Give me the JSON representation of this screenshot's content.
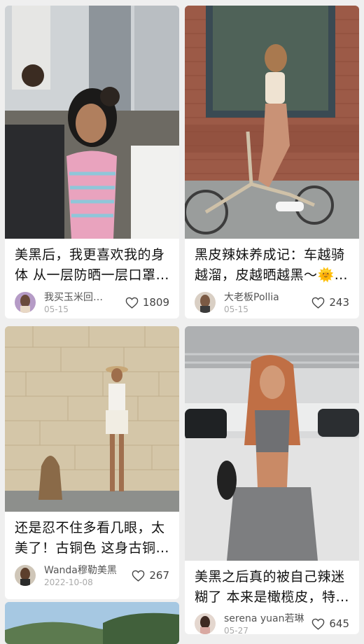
{
  "posts": [
    {
      "title_line1": "美黑后，我更喜欢我的身",
      "title_line2": "体 从一层防晒一层口罩…",
      "author": "我买玉米回…",
      "date": "05-15",
      "likes": "1809",
      "photo_icon": "photo-woman-striped-dress"
    },
    {
      "title_line1": "黑皮辣妹养成记：车越骑",
      "title_line2": "越溜，皮越晒越黑～🌞…",
      "author": "大老板Pollia",
      "date": "05-15",
      "likes": "243",
      "photo_icon": "photo-woman-bicycle"
    },
    {
      "title_line1": "还是忍不住多看几眼，太",
      "title_line2": "美了！古铜色 这身古铜…",
      "author": "Wanda穆勒美黑",
      "date": "2022-10-08",
      "likes": "267",
      "photo_icon": "photo-woman-stone-wall"
    },
    {
      "title_line1": "美黑之后真的被自己辣迷",
      "title_line2": "糊了 本来是橄榄皮，特…",
      "author": "serena yuan若琳",
      "date": "05-27",
      "likes": "645",
      "photo_icon": "photo-woman-parking-garage"
    }
  ],
  "colors": {
    "background": "#efefef",
    "card": "#ffffff",
    "like_icon": "#444444"
  },
  "icons": {
    "like": "heart-outline-icon"
  }
}
